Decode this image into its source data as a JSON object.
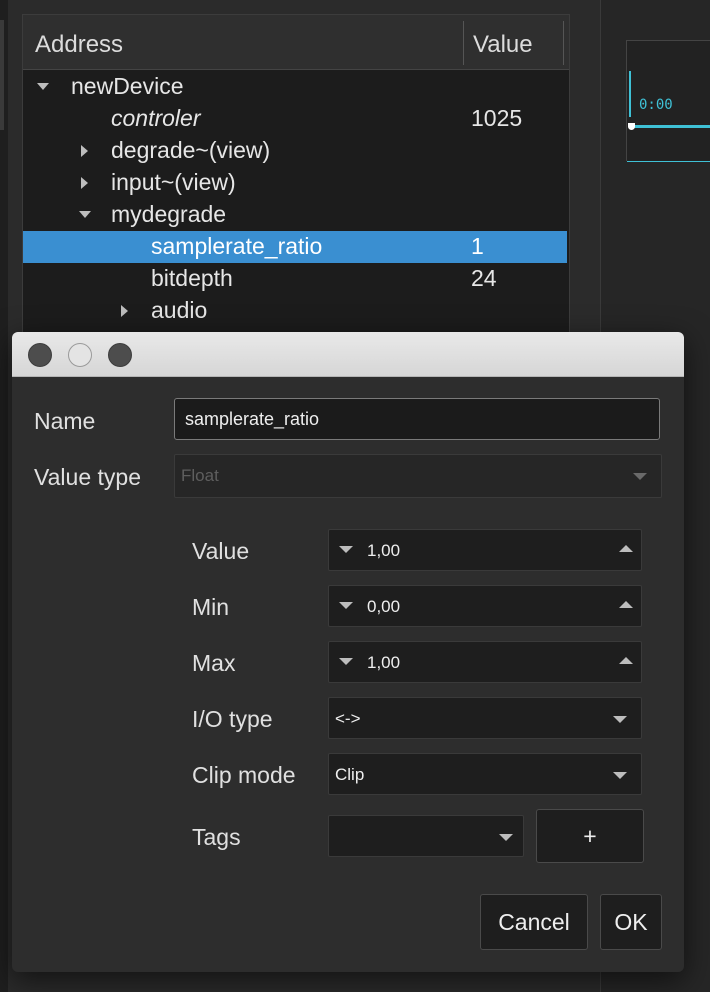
{
  "tree": {
    "headers": {
      "address": "Address",
      "value": "Value"
    },
    "rows": [
      {
        "label": "newDevice",
        "value": ""
      },
      {
        "label": "controler",
        "value": "1025"
      },
      {
        "label": "degrade~(view)",
        "value": ""
      },
      {
        "label": "input~(view)",
        "value": ""
      },
      {
        "label": "mydegrade",
        "value": ""
      },
      {
        "label": "samplerate_ratio",
        "value": "1"
      },
      {
        "label": "bitdepth",
        "value": "24"
      },
      {
        "label": "audio",
        "value": ""
      }
    ]
  },
  "timeline": {
    "time": "0:00"
  },
  "dialog": {
    "name_label": "Name",
    "name_value": "samplerate_ratio",
    "value_type_label": "Value type",
    "value_type": "Float",
    "value_label": "Value",
    "value": "1,00",
    "min_label": "Min",
    "min": "0,00",
    "max_label": "Max",
    "max": "1,00",
    "io_type_label": "I/O type",
    "io_type": "<->",
    "clip_mode_label": "Clip mode",
    "clip_mode": "Clip",
    "tags_label": "Tags",
    "tags_value": "",
    "add_tag_label": "+",
    "cancel_label": "Cancel",
    "ok_label": "OK"
  }
}
